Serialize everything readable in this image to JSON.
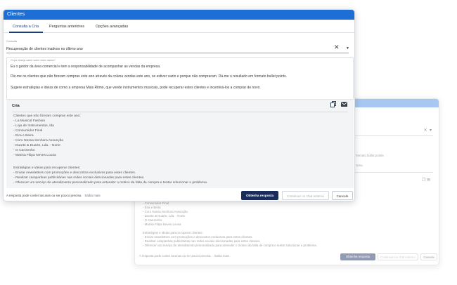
{
  "window": {
    "title": "Clientes"
  },
  "tabs": [
    {
      "label": "Consulta a Cria"
    },
    {
      "label": "Perguntas anteriores"
    },
    {
      "label": "Opções avançadas"
    }
  ],
  "select": {
    "label": "Consulta",
    "value": "Recuperação de clientes inativos no último ano"
  },
  "prompt": {
    "label": "O que deseja saber sobre estes dados?",
    "paragraphs": [
      "Eu o gestor da área comercial e tem a responsabilidade de acompanhar as vendas da empresa.",
      "Diz-me os clientes que não fizeram compras este ano através da coluna vendas este ano, se estiver vazio e porque não compraram. Dá-me o resultado em formato bullet points.",
      "Sugere estratégias e ideias de como a empresa Mais Ritmo, que vende instrumentos musicais, pode recuperar estes clientes e incentivá-los a comprar de novo."
    ]
  },
  "response": {
    "title": "Cria",
    "lines": [
      "Clientes que não fizeram compras este ano:",
      "- La Musical Fashion",
      "- Loja de Instrumentos, lda",
      "- Consumidor Final",
      "- Eira e Beira",
      "- Coro Nossa Senhora Assunção",
      "- Duarte & Duarte, Lda. - Norte",
      "- O Canzenho",
      "- Marisa Filipa Neves Lousa",
      "",
      "Estratégias e ideias para recuperar clientes:",
      "- Enviar newsletters com promoções e descontos exclusivos para estes clientes.",
      "- Realizar campanhas publicitárias nas redes sociais direcionadas para estes clientes.",
      "- Oferecer um serviço de atendimento personalizado para entender o motivo da falta de compra e tentar solucionar o problema."
    ]
  },
  "footer": {
    "note": "A resposta pode conter lacunas ou ser pouco precisa.",
    "link": "Saiba mais",
    "primary_button": "Obtenha resposta",
    "secondary_button": "Continuar no chat externo",
    "cancel_button": "Cancele"
  },
  "back_window": {
    "prompt_snippet_1": "formato bullet points.",
    "prompt_snippet_2": "novo.",
    "response_lines": [
      "- Consumidor Final",
      "- Eira e Beira",
      "- Coro Nossa Senhora Assunção",
      "- Duarte & Duarte, Lda. - Norte",
      "- O Canzenho",
      "- Marisa Filipa Neves Lousa",
      "",
      "Estratégias e ideias para recuperar clientes:",
      "- Enviar newsletters com promoções e descontos exclusivos para estes clientes.",
      "- Realizar campanhas publicitárias nas redes sociais direcionadas para estes clientes.",
      "- Oferecer um serviço de atendimento personalizado para entender o motivo da falta de compra e tentar solucionar o problema."
    ],
    "note": "A resposta pode conter lacunas ou ser pouco precisa.",
    "link": "Saiba mais",
    "primary_button": "Obtenha resposta",
    "secondary_button": "Continuar no chat externo",
    "cancel_button": "Cancele"
  },
  "colors": {
    "titlebar": "#1d6fd6",
    "primary_button": "#1a2d5a",
    "tab_active": "#1d3f7a"
  }
}
